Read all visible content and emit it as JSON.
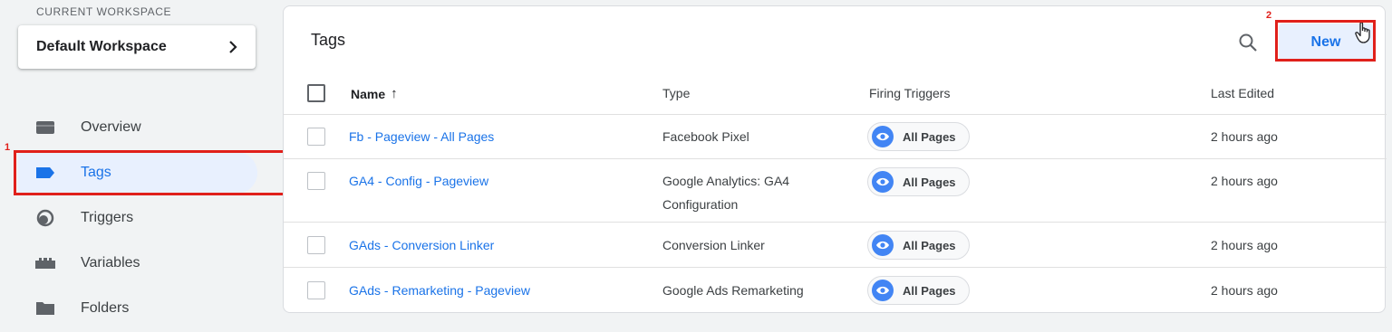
{
  "sidebar": {
    "workspace_label": "CURRENT WORKSPACE",
    "workspace_name": "Default Workspace",
    "items": [
      {
        "label": "Overview",
        "icon": "overview-icon"
      },
      {
        "label": "Tags",
        "icon": "tag-icon",
        "active": true
      },
      {
        "label": "Triggers",
        "icon": "trigger-icon"
      },
      {
        "label": "Variables",
        "icon": "variables-icon"
      },
      {
        "label": "Folders",
        "icon": "folder-icon"
      }
    ]
  },
  "annotations": {
    "one": "1",
    "two": "2"
  },
  "main": {
    "title": "Tags",
    "new_label": "New",
    "columns": {
      "name": "Name",
      "type": "Type",
      "triggers": "Firing Triggers",
      "edited": "Last Edited"
    },
    "sort_arrow": "↑",
    "rows": [
      {
        "name": "Fb - Pageview - All Pages",
        "type": "Facebook Pixel",
        "type2": "",
        "trigger": "All Pages",
        "edited": "2 hours ago"
      },
      {
        "name": "GA4 - Config - Pageview",
        "type": "Google Analytics: GA4",
        "type2": "Configuration",
        "trigger": "All Pages",
        "edited": "2 hours ago"
      },
      {
        "name": "GAds - Conversion Linker",
        "type": "Conversion Linker",
        "type2": "",
        "trigger": "All Pages",
        "edited": "2 hours ago"
      },
      {
        "name": "GAds - Remarketing - Pageview",
        "type": "Google Ads Remarketing",
        "type2": "",
        "trigger": "All Pages",
        "edited": "2 hours ago"
      }
    ]
  },
  "colors": {
    "accent": "#1a73e8",
    "annotation": "#e0201b",
    "chip_icon": "#4285f4"
  }
}
